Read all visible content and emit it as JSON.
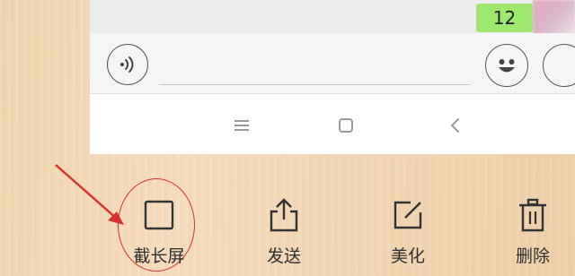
{
  "preview": {
    "message_bubble_text": "12",
    "voice_icon": "voice-input-icon",
    "emoji_icon": "smiley-face-icon",
    "nav_icons": [
      "menu-lines-icon",
      "square-home-icon",
      "back-chevron-icon"
    ]
  },
  "actions": [
    {
      "id": "screenshot",
      "icon": "square-outline-icon",
      "label": "截长屏"
    },
    {
      "id": "send",
      "icon": "share-upload-icon",
      "label": "发送"
    },
    {
      "id": "beautify",
      "icon": "edit-pencil-icon",
      "label": "美化"
    },
    {
      "id": "delete",
      "icon": "trash-icon",
      "label": "删除"
    }
  ],
  "colors": {
    "annotation": "#d8312a",
    "bubble": "#9fe870",
    "wood": "#f3d6b3"
  }
}
